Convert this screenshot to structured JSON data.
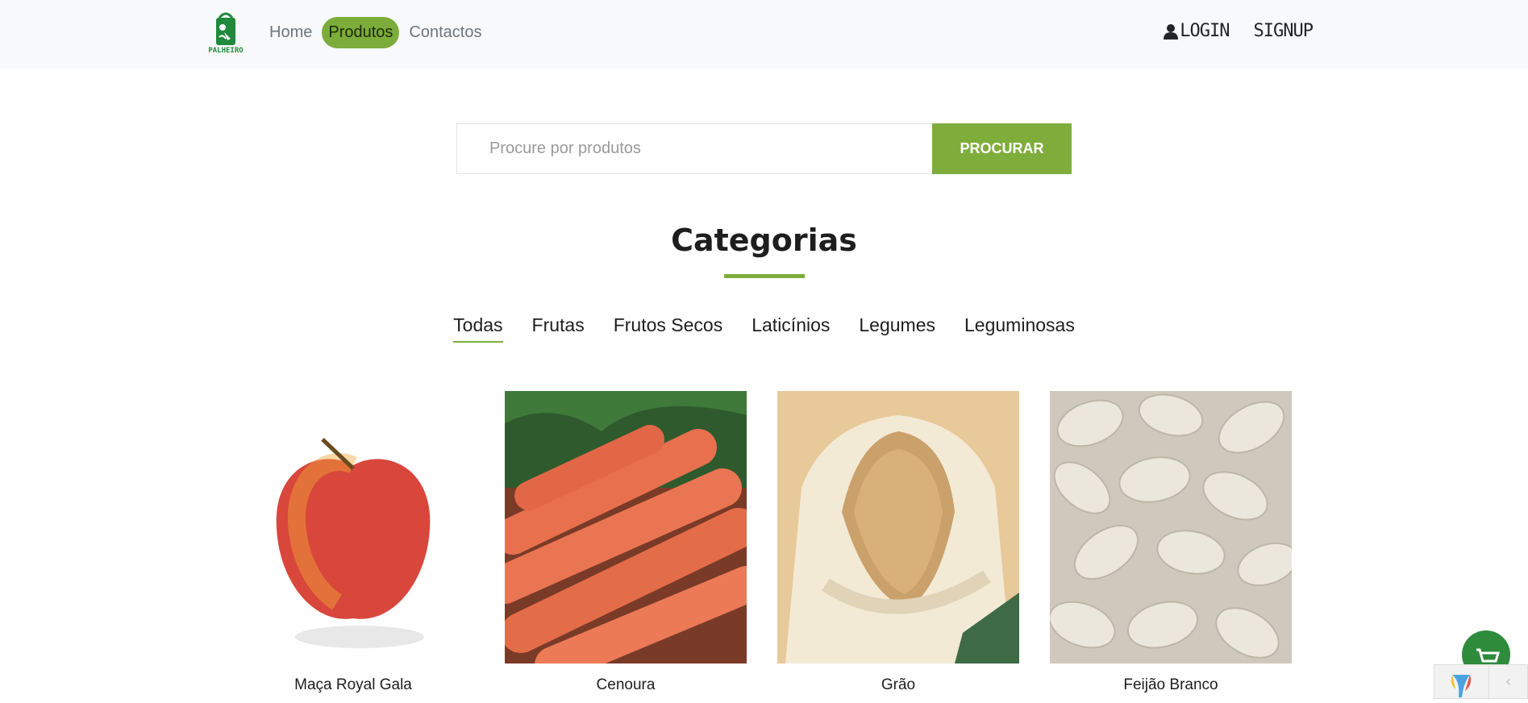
{
  "brand": {
    "logo_text": "PALHEIRO"
  },
  "nav": {
    "items": [
      {
        "label": "Home",
        "active": false
      },
      {
        "label": "Produtos",
        "active": true
      },
      {
        "label": "Contactos",
        "active": false
      }
    ],
    "login": "LOGIN",
    "signup": "SIGNUP"
  },
  "search": {
    "placeholder": "Procure por produtos",
    "button_label": "PROCURAR"
  },
  "categories": {
    "title": "Categorias",
    "tabs": [
      "Todas",
      "Frutas",
      "Frutos Secos",
      "Laticínios",
      "Legumes",
      "Leguminosas"
    ],
    "active": "Todas"
  },
  "products": [
    {
      "name": "Maça Royal Gala",
      "image": "apple"
    },
    {
      "name": "Cenoura",
      "image": "carrots"
    },
    {
      "name": "Grão",
      "image": "chickpeas-sack"
    },
    {
      "name": "Feijão Branco",
      "image": "white-beans"
    }
  ],
  "colors": {
    "accent": "#7fad3c",
    "brand_green": "#1f8a3b",
    "fab": "#2e8b3c"
  },
  "icons": [
    "bag-logo-icon",
    "user-icon",
    "cart-icon",
    "chevron-left-icon"
  ]
}
